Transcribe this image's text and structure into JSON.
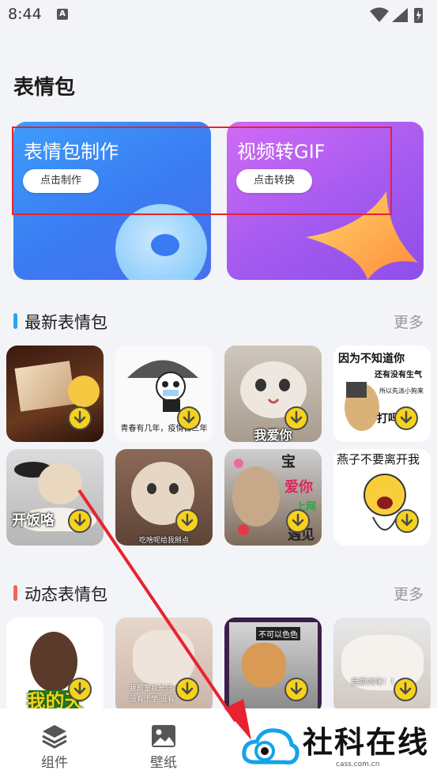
{
  "status": {
    "time": "8:44",
    "notif_letter": "A"
  },
  "page_title": "表情包",
  "hero": [
    {
      "title": "表情包制作",
      "button": "点击制作"
    },
    {
      "title": "视频转GIF",
      "button": "点击转换"
    }
  ],
  "latest": {
    "title": "最新表情包",
    "more": "更多",
    "captions": [
      "",
      "青春有几年，疫情占三年",
      "我爱你",
      "因为不知道你",
      "还有没有生气",
      "所以先派小狗来",
      "打吗",
      "开饭咯",
      "吃啥呢给我掰点",
      "宝",
      "爱你",
      "遇见你",
      "燕子不要离开我",
      "宝贝",
      "上网"
    ]
  },
  "animated": {
    "title": "动态表情包",
    "more": "更多",
    "captions": [
      "我的天",
      "我前室我是只",
      "没有上学 没有",
      "不可以色色",
      "我要妈咪！！"
    ]
  },
  "nav": [
    {
      "label": "组件"
    },
    {
      "label": "壁纸"
    }
  ],
  "watermark": {
    "text": "社科在线",
    "domain": "cass.com.cn"
  },
  "colors": {
    "accent_blue": "#3a7bf2",
    "accent_purple": "#a45af0",
    "highlight_red": "#e8232f",
    "section_bar_blue": "#2ba3f5",
    "section_bar_red": "#f0665a"
  }
}
